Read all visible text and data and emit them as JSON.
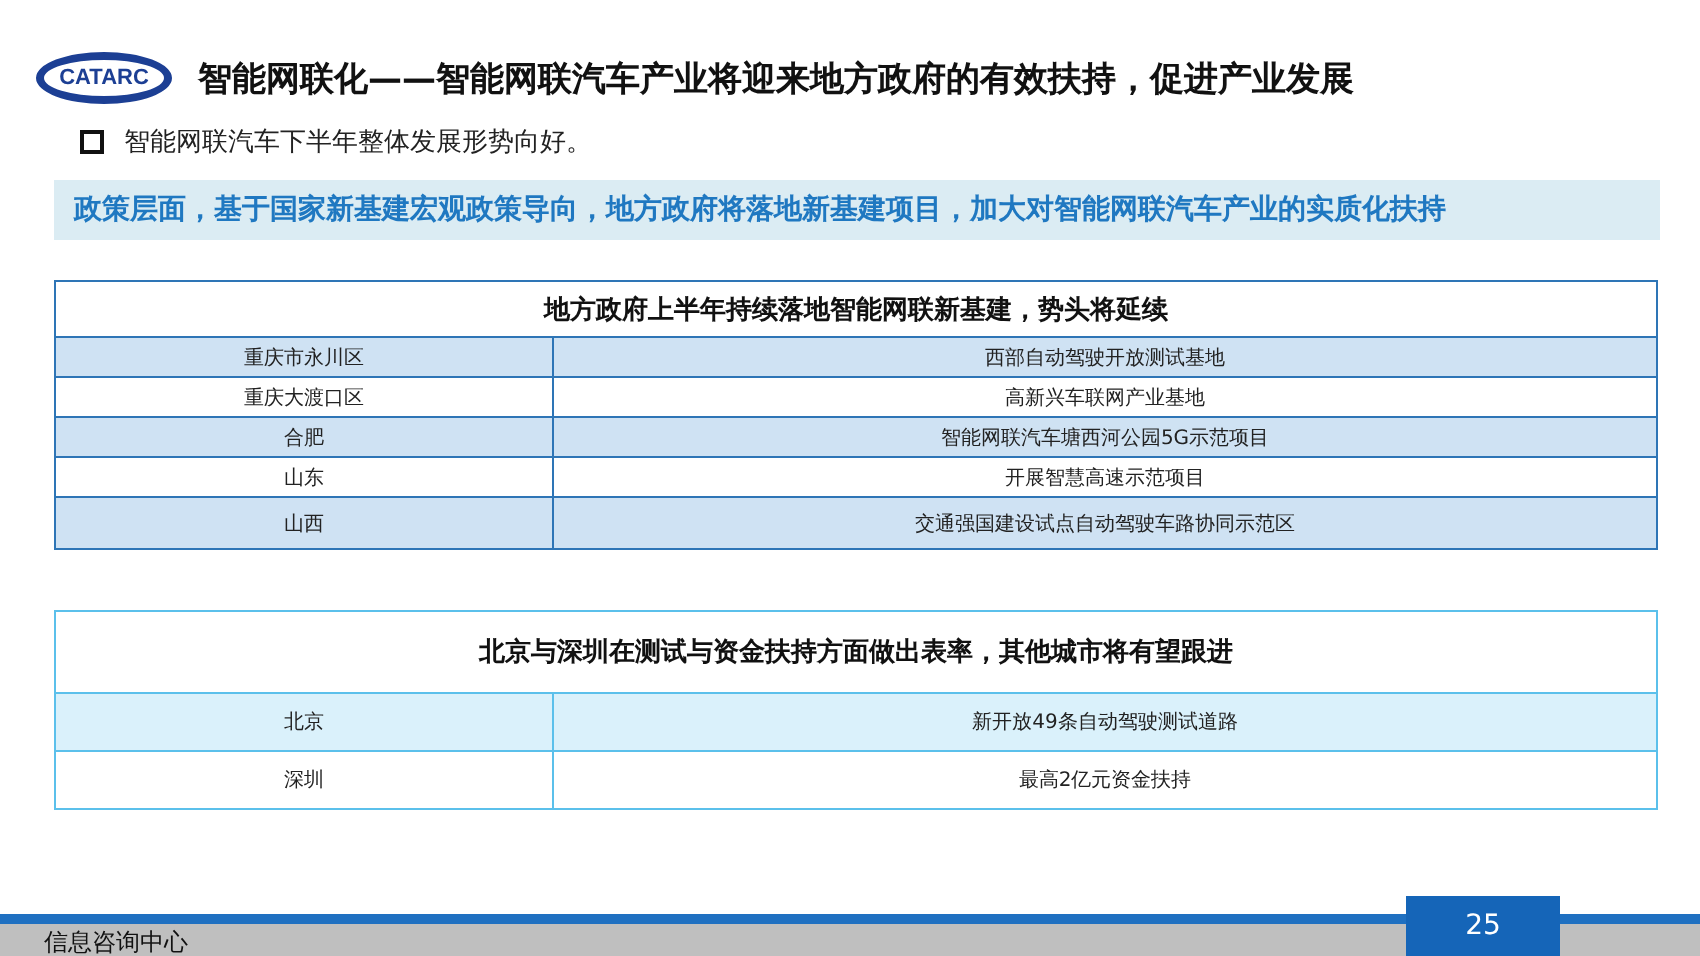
{
  "header": {
    "logo_text": "CATARC",
    "title": "智能网联化——智能网联汽车产业将迎来地方政府的有效扶持，促进产业发展"
  },
  "bullet": "智能网联汽车下半年整体发展形势向好。",
  "highlight": "政策层面，基于国家新基建宏观政策导向，地方政府将落地新基建项目，加大对智能网联汽车产业的实质化扶持",
  "tables": [
    {
      "title": "地方政府上半年持续落地智能网联新基建，势头将延续",
      "rows": [
        [
          "重庆市永川区",
          "西部自动驾驶开放测试基地"
        ],
        [
          "重庆大渡口区",
          "高新兴车联网产业基地"
        ],
        [
          "合肥",
          "智能网联汽车塘西河公园5G示范项目"
        ],
        [
          "山东",
          "开展智慧高速示范项目"
        ],
        [
          "山西",
          "交通强国建设试点自动驾驶车路协同示范区"
        ]
      ]
    },
    {
      "title": "北京与深圳在测试与资金扶持方面做出表率，其他城市将有望跟进",
      "rows": [
        [
          "北京",
          "新开放49条自动驾驶测试道路"
        ],
        [
          "深圳",
          "最高2亿元资金扶持"
        ]
      ]
    }
  ],
  "footer": {
    "org": "信息咨询中心",
    "page": "25"
  }
}
